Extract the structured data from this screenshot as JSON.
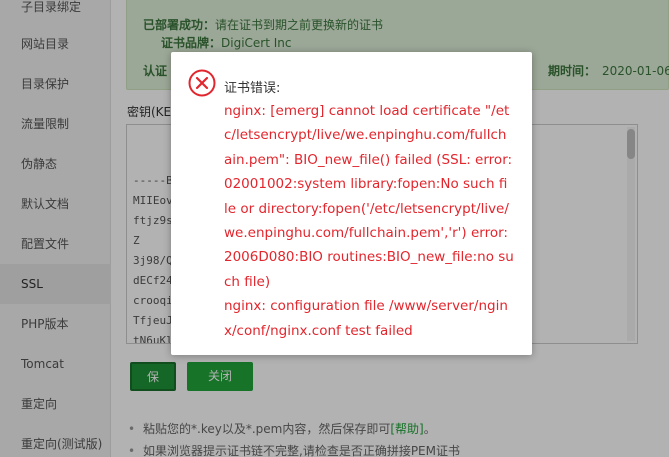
{
  "sidebar": {
    "items": [
      {
        "label": "子目录绑定"
      },
      {
        "label": "网站目录"
      },
      {
        "label": "目录保护"
      },
      {
        "label": "流量限制"
      },
      {
        "label": "伪静态"
      },
      {
        "label": "默认文档"
      },
      {
        "label": "配置文件"
      },
      {
        "label": "SSL"
      },
      {
        "label": "PHP版本"
      },
      {
        "label": "Tomcat"
      },
      {
        "label": "重定向"
      },
      {
        "label": "重定向(测试版)"
      }
    ],
    "active_index": 7
  },
  "success": {
    "deployed_label": "已部署成功：",
    "deployed_text": "请在证书到期之前更换新的证书",
    "brand_label": "证书品牌：",
    "brand_value": "DigiCert Inc",
    "auth_label": "认证",
    "expire_label": "期时间：",
    "expire_value": "2020-01-06"
  },
  "key_label": "密钥(KEY)",
  "cert_lines": [
    "-----BE                                   E-----",
    "MIIEov                                   QCx6+8SBLgbh",
    "ftjz9s1                                  kiG9w0BAQsFA",
    "Z",
    "3j98/Q                                   YUzEVMBMGA1",
    "dECf24                                   gSW5jMRkwFw",
    "crooqi",
    "TfjeuJF                                  9tMS0wKwYDV",
    "tN6uKl                                   9uIEV2ZXJ5d2",
    "Dhjbnv"
  ],
  "buttons": {
    "save": "保存",
    "close_ssl": "关闭SSL"
  },
  "help": {
    "line1_text": "粘贴您的*.key以及*.pem内容，然后保存即可",
    "line1_link": "[帮助]",
    "line1_end": "。",
    "line2_text": "如果浏览器提示证书链不完整,请检查是否正确拼接PEM证书"
  },
  "dialog": {
    "title": "证书错误:",
    "icon": "error-circle-icon",
    "lines": [
      "nginx: [emerg] cannot load certificate \"/et",
      "c/letsencrypt/live/we.enpinghu.com/fullch",
      "ain.pem\": BIO_new_file() failed (SSL: error:",
      "02001002:system library:fopen:No such fi",
      "le or directory:fopen('/etc/letsencrypt/live/",
      "we.enpinghu.com/fullchain.pem','r') error:",
      "2006D080:BIO routines:BIO_new_file:no su",
      "ch file)",
      "nginx: configuration file /www/server/ngin",
      "x/conf/nginx.conf test failed"
    ]
  },
  "colors": {
    "error_red": "#e2262d",
    "brand_green": "#20a53a",
    "success_bg": "#dff0d8",
    "success_text": "#3c763d"
  }
}
